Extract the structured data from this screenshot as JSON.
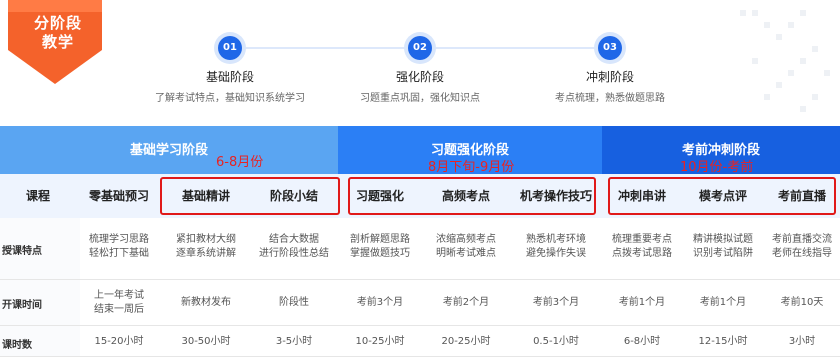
{
  "badge": {
    "line1": "分阶段",
    "line2": "教学"
  },
  "steps": [
    {
      "num": "01",
      "title": "基础阶段",
      "desc": "了解考试特点，基础知识系统学习"
    },
    {
      "num": "02",
      "title": "强化阶段",
      "desc": "习题重点巩固，强化知识点"
    },
    {
      "num": "03",
      "title": "冲刺阶段",
      "desc": "考点梳理，熟悉做题思路"
    }
  ],
  "phases": [
    {
      "name": "基础学习阶段",
      "note": "6-8月份"
    },
    {
      "name": "习题强化阶段",
      "note": "8月下旬-9月份"
    },
    {
      "name": "考前冲刺阶段",
      "note": "10月份-考前"
    }
  ],
  "header": {
    "label": "课程",
    "courses": [
      "零基础预习",
      "基础精讲",
      "阶段小结",
      "习题强化",
      "高频考点",
      "机考操作技巧",
      "冲刺串讲",
      "模考点评",
      "考前直播"
    ]
  },
  "rows": [
    {
      "label": "授课特点",
      "values": [
        "梳理学习思路\n轻松打下基础",
        "紧扣教材大纲\n逐章系统讲解",
        "结合大数据\n进行阶段性总结",
        "剖析解题思路\n掌握做题技巧",
        "浓缩高频考点\n明晰考试难点",
        "熟悉机考环境\n避免操作失误",
        "梳理重要考点\n点拨考试思路",
        "精讲模拟试题\n识别考试陷阱",
        "考前直播交流\n老师在线指导"
      ]
    },
    {
      "label": "开课时间",
      "values": [
        "上一年考试\n结束一周后",
        "新教材发布",
        "阶段性",
        "考前3个月",
        "考前2个月",
        "考前3个月",
        "考前1个月",
        "考前1个月",
        "考前10天"
      ]
    },
    {
      "label": "课时数",
      "values": [
        "15-20小时",
        "30-50小时",
        "3-5小时",
        "10-25小时",
        "20-25小时",
        "0.5-1小时",
        "6-8小时",
        "12-15小时",
        "3小时"
      ]
    }
  ],
  "colors": {
    "primary": "#1f67e8",
    "phase1": "#5aa5f2",
    "phase2": "#2b7ff5",
    "phase3": "#1760e0",
    "badge": "#f4622b",
    "annotation": "#e01919"
  }
}
